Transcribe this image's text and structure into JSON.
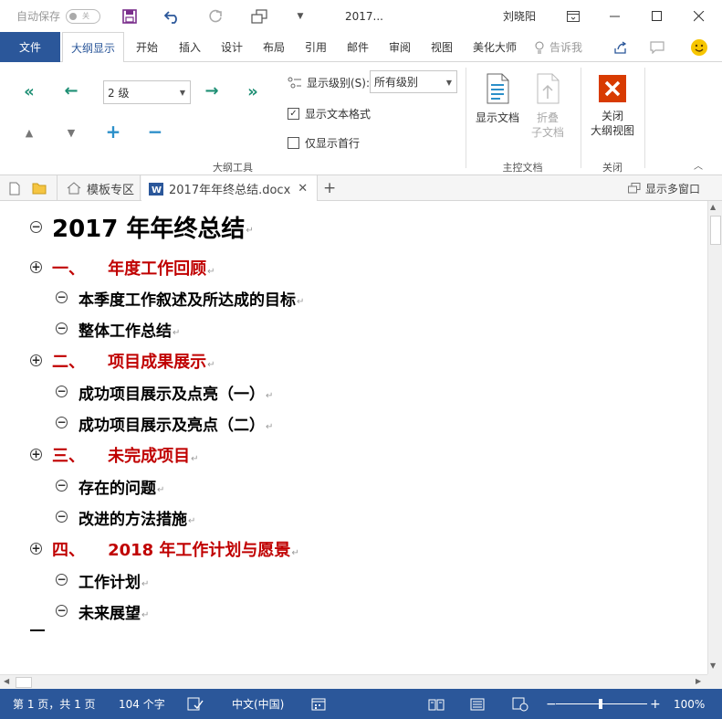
{
  "titlebar": {
    "autosave_label": "自动保存",
    "autosave_state": "关",
    "doc_title": "2017...",
    "user_name": "刘晓阳"
  },
  "ribbon_tabs": [
    "文件",
    "大纲显示",
    "开始",
    "插入",
    "设计",
    "布局",
    "引用",
    "邮件",
    "审阅",
    "视图",
    "美化大师"
  ],
  "tell_me": "告诉我",
  "outline_tools": {
    "level_value": "2 级",
    "show_level_label": "显示级别(S):",
    "show_level_value": "所有级别",
    "show_text_format": "显示文本格式",
    "show_first_line": "仅显示首行",
    "group_label": "大纲工具"
  },
  "master_doc": {
    "show_doc": "显示文档",
    "collapse_line1": "折叠",
    "collapse_line2": "子文档",
    "group_label": "主控文档"
  },
  "close_group": {
    "close_line1": "关闭",
    "close_line2": "大纲视图",
    "group_label": "关闭"
  },
  "doc_tabs": {
    "template_tab": "模板专区",
    "doc_tab": "2017年年终总结.docx",
    "multi_window": "显示多窗口"
  },
  "outline": [
    {
      "text": "2017 年年终总结",
      "level": 0,
      "sym": "−",
      "color": "#000000"
    },
    {
      "text": "一、    年度工作回顾",
      "level": 1,
      "sym": "+",
      "color": "#c00000"
    },
    {
      "text": "本季度工作叙述及所达成的目标",
      "level": 2,
      "sym": "−",
      "color": "#000000"
    },
    {
      "text": "整体工作总结",
      "level": 2,
      "sym": "−",
      "color": "#000000"
    },
    {
      "text": "二、    项目成果展示",
      "level": 1,
      "sym": "+",
      "color": "#c00000"
    },
    {
      "text": "成功项目展示及点亮（一）",
      "level": 2,
      "sym": "−",
      "color": "#000000"
    },
    {
      "text": "成功项目展示及亮点（二）",
      "level": 2,
      "sym": "−",
      "color": "#000000"
    },
    {
      "text": "三、    未完成项目",
      "level": 1,
      "sym": "+",
      "color": "#c00000"
    },
    {
      "text": "存在的问题",
      "level": 2,
      "sym": "−",
      "color": "#000000"
    },
    {
      "text": "改进的方法措施",
      "level": 2,
      "sym": "−",
      "color": "#000000"
    },
    {
      "text": "四、    2018 年工作计划与愿景",
      "level": 1,
      "sym": "+",
      "color": "#c00000"
    },
    {
      "text": "工作计划",
      "level": 2,
      "sym": "−",
      "color": "#000000"
    },
    {
      "text": "未来展望",
      "level": 2,
      "sym": "−",
      "color": "#000000"
    }
  ],
  "statusbar": {
    "page": "第 1 页，共 1 页",
    "words": "104 个字",
    "language": "中文(中国)",
    "zoom": "100%"
  },
  "colors": {
    "brand": "#2b579a",
    "heading_red": "#c00000",
    "arrow_green": "#1e8f74"
  }
}
